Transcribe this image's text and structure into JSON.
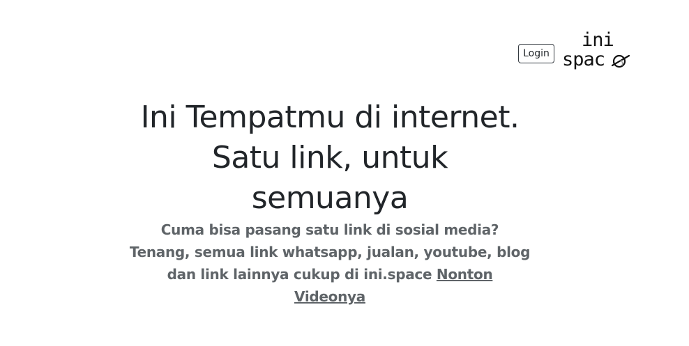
{
  "header": {
    "login_label": "Login",
    "logo": {
      "line1": "ini",
      "line2": "spac"
    }
  },
  "hero": {
    "title_lines": [
      "Ini Tempatmu di internet.",
      "Satu link, untuk",
      "semuanya"
    ],
    "subtitle_lines": [
      "Cuma bisa pasang satu link di sosial media?",
      "Tenang, semua link whatsapp, jualan, youtube, blog",
      "dan link lainnya cukup di ini.space "
    ],
    "video_link_part1": "Nonton",
    "video_link_part2": "Videonya"
  },
  "colors": {
    "title": "#212529",
    "subtitle": "#5f6468",
    "background": "#ffffff"
  }
}
